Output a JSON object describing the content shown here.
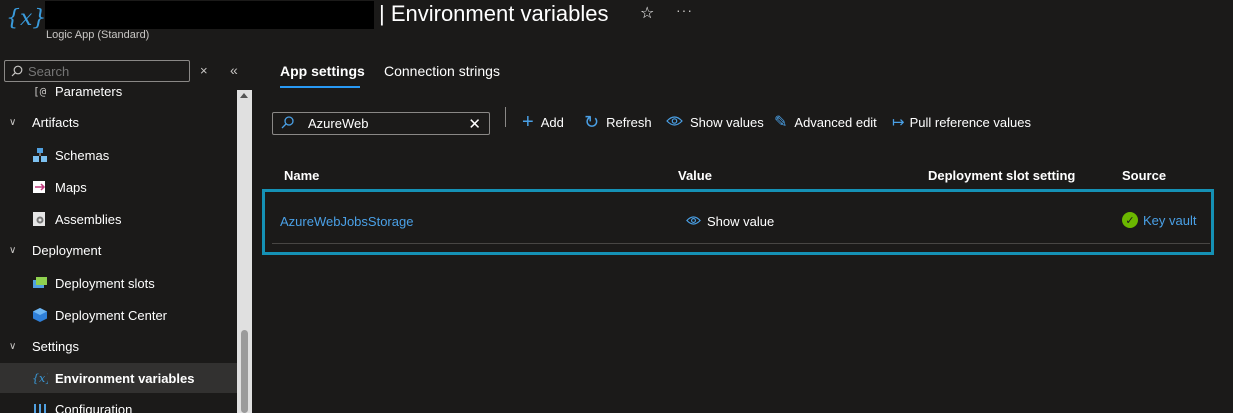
{
  "header": {
    "app_icon_glyph": "{x}",
    "title": "| Environment variables",
    "subtitle": "Logic App (Standard)",
    "favorite_icon": "star-icon",
    "more_icon": "ellipsis-icon",
    "more_glyph": "···"
  },
  "sidebar": {
    "search_placeholder": "Search",
    "clear_glyph": "×",
    "collapse_glyph": "«",
    "items": [
      {
        "type": "item",
        "label": "Parameters",
        "icon": "parameters-icon"
      },
      {
        "type": "group",
        "label": "Artifacts"
      },
      {
        "type": "item",
        "label": "Schemas",
        "icon": "schemas-icon"
      },
      {
        "type": "item",
        "label": "Maps",
        "icon": "maps-icon"
      },
      {
        "type": "item",
        "label": "Assemblies",
        "icon": "assemblies-icon"
      },
      {
        "type": "group",
        "label": "Deployment"
      },
      {
        "type": "item",
        "label": "Deployment slots",
        "icon": "deployment-slots-icon"
      },
      {
        "type": "item",
        "label": "Deployment Center",
        "icon": "deployment-center-icon"
      },
      {
        "type": "group",
        "label": "Settings"
      },
      {
        "type": "item",
        "label": "Environment variables",
        "icon": "environment-variables-icon",
        "active": true
      },
      {
        "type": "item",
        "label": "Configuration",
        "icon": "configuration-icon"
      }
    ]
  },
  "tabs": [
    {
      "label": "App settings",
      "active": true
    },
    {
      "label": "Connection strings",
      "active": false
    }
  ],
  "filter": {
    "value": "AzureWeb",
    "clear_glyph": "✕"
  },
  "toolbar": {
    "add_label": "Add",
    "refresh_label": "Refresh",
    "show_values_label": "Show values",
    "advanced_edit_label": "Advanced edit",
    "pull_reference_label": "Pull reference values"
  },
  "table": {
    "columns": [
      "Name",
      "Value",
      "Deployment slot setting",
      "Source"
    ],
    "rows": [
      {
        "name": "AzureWebJobsStorage",
        "value": "Show value",
        "deployment_slot_setting": "",
        "source": "Key vault",
        "source_status": "success"
      }
    ]
  },
  "colors": {
    "accent": "#4aa0e6",
    "highlight_border": "#1591b5",
    "success": "#6bb700",
    "background": "#1b1a19"
  }
}
